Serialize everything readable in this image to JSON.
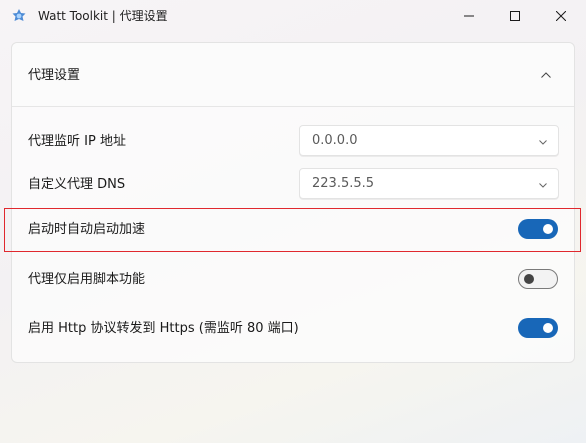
{
  "window": {
    "title": "Watt Toolkit | 代理设置"
  },
  "panel": {
    "title": "代理设置",
    "collapse_icon": "chevron-up-icon"
  },
  "settings": {
    "listen_ip": {
      "label": "代理监听 IP 地址",
      "value": "0.0.0.0"
    },
    "custom_dns": {
      "label": "自定义代理 DNS",
      "value": "223.5.5.5"
    },
    "auto_start": {
      "label": "启动时自动启动加速",
      "enabled": true
    },
    "script_only": {
      "label": "代理仅启用脚本功能",
      "enabled": false
    },
    "http_to_https": {
      "label": "启用 Http 协议转发到 Https (需监听 80 端口)",
      "enabled": true
    }
  },
  "colors": {
    "accent": "#1867b8",
    "highlight": "#e0282e"
  }
}
